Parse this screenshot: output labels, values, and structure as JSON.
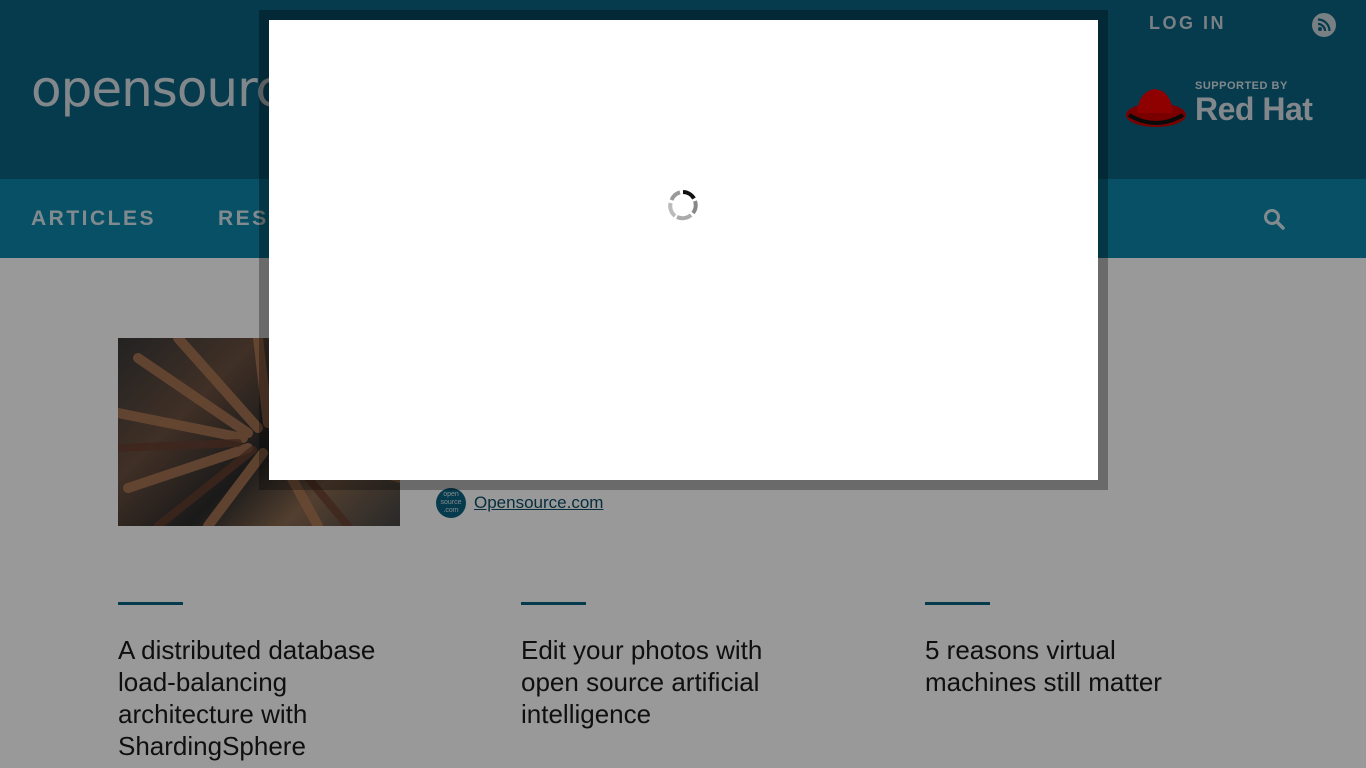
{
  "header": {
    "logo_text": "opensource",
    "login_label": "LOG IN",
    "sponsor_small": "SUPPORTED BY",
    "sponsor_name": "Red Hat"
  },
  "nav": {
    "items": [
      {
        "label": "ARTICLES"
      },
      {
        "label": "RESO"
      }
    ]
  },
  "featured": {
    "author_avatar_text": "open source .com",
    "author": "Opensource.com"
  },
  "cards": [
    {
      "title": "A distributed database load-balancing architecture with ShardingSphere"
    },
    {
      "title": "Edit your photos with open source artificial intelligence"
    },
    {
      "title": "5 reasons virtual machines still matter"
    }
  ],
  "icons": {
    "rss": "rss-icon",
    "search": "search-icon",
    "spinner": "loading-spinner-icon",
    "hat": "redhat-logo-icon"
  },
  "colors": {
    "header_bg": "#0b6383",
    "nav_bg": "#0d86a8",
    "accent": "#0b6383"
  }
}
